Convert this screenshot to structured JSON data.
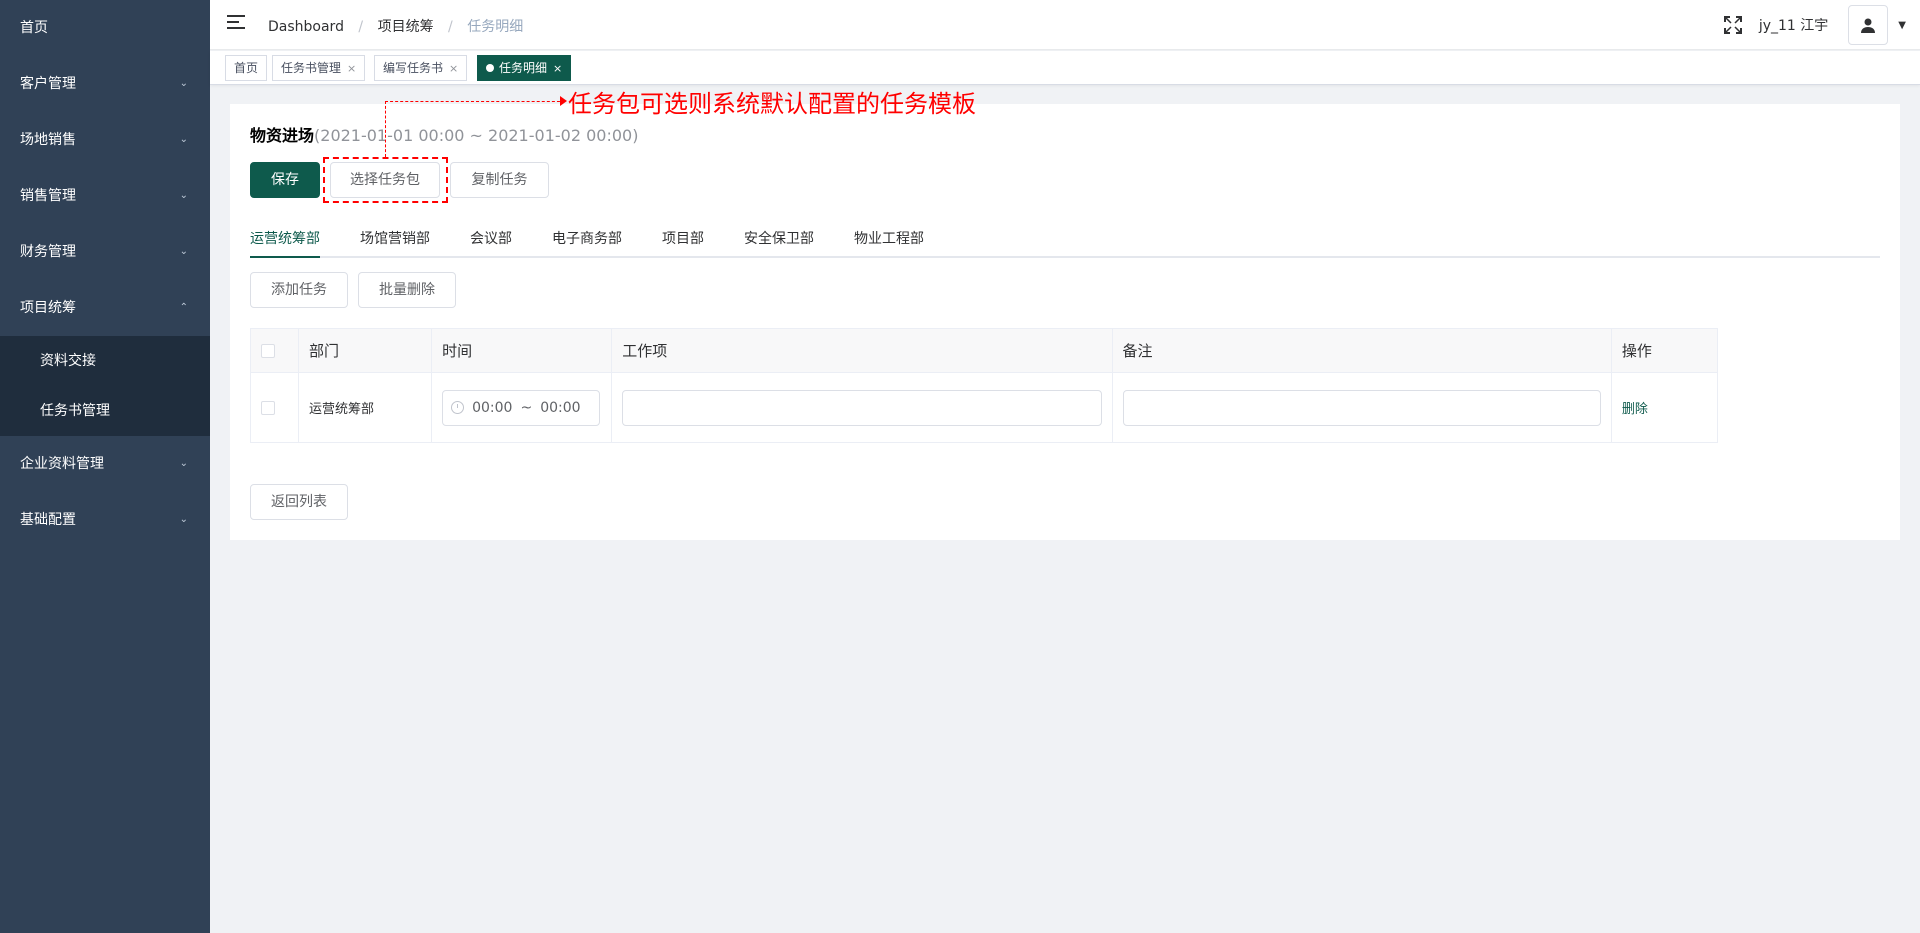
{
  "sidebar": {
    "items": [
      {
        "label": "首页"
      },
      {
        "label": "客户管理"
      },
      {
        "label": "场地销售"
      },
      {
        "label": "销售管理"
      },
      {
        "label": "财务管理"
      },
      {
        "label": "项目统筹"
      },
      {
        "label": "企业资料管理"
      },
      {
        "label": "基础配置"
      }
    ],
    "sub_items": [
      {
        "label": "资料交接"
      },
      {
        "label": "任务书管理"
      }
    ]
  },
  "navbar": {
    "breadcrumb": [
      "Dashboard",
      "项目统筹",
      "任务明细"
    ],
    "username": "jy_11 江宇"
  },
  "tags": [
    {
      "label": "首页"
    },
    {
      "label": "任务书管理"
    },
    {
      "label": "编写任务书"
    },
    {
      "label": "任务明细"
    }
  ],
  "page": {
    "title": "物资进场",
    "time_range": "(2021-01-01 00:00 ~ 2021-01-02 00:00)",
    "save_label": "保存",
    "select_package_label": "选择任务包",
    "copy_task_label": "复制任务",
    "add_task_label": "添加任务",
    "batch_delete_label": "批量删除",
    "back_label": "返回列表"
  },
  "tabs": [
    "运营统筹部",
    "场馆营销部",
    "会议部",
    "电子商务部",
    "项目部",
    "安全保卫部",
    "物业工程部"
  ],
  "table": {
    "headers": [
      "部门",
      "时间",
      "工作项",
      "备注",
      "操作"
    ],
    "rows": [
      {
        "department": "运营统筹部",
        "start": "00:00",
        "sep": "~",
        "end": "00:00",
        "action": "删除"
      }
    ]
  },
  "annotation": {
    "text": "任务包可选则系统默认配置的任务模板"
  },
  "colors": {
    "accent": "#0e5a4c",
    "sidebar": "#304156",
    "annotation": "#ff0000"
  }
}
